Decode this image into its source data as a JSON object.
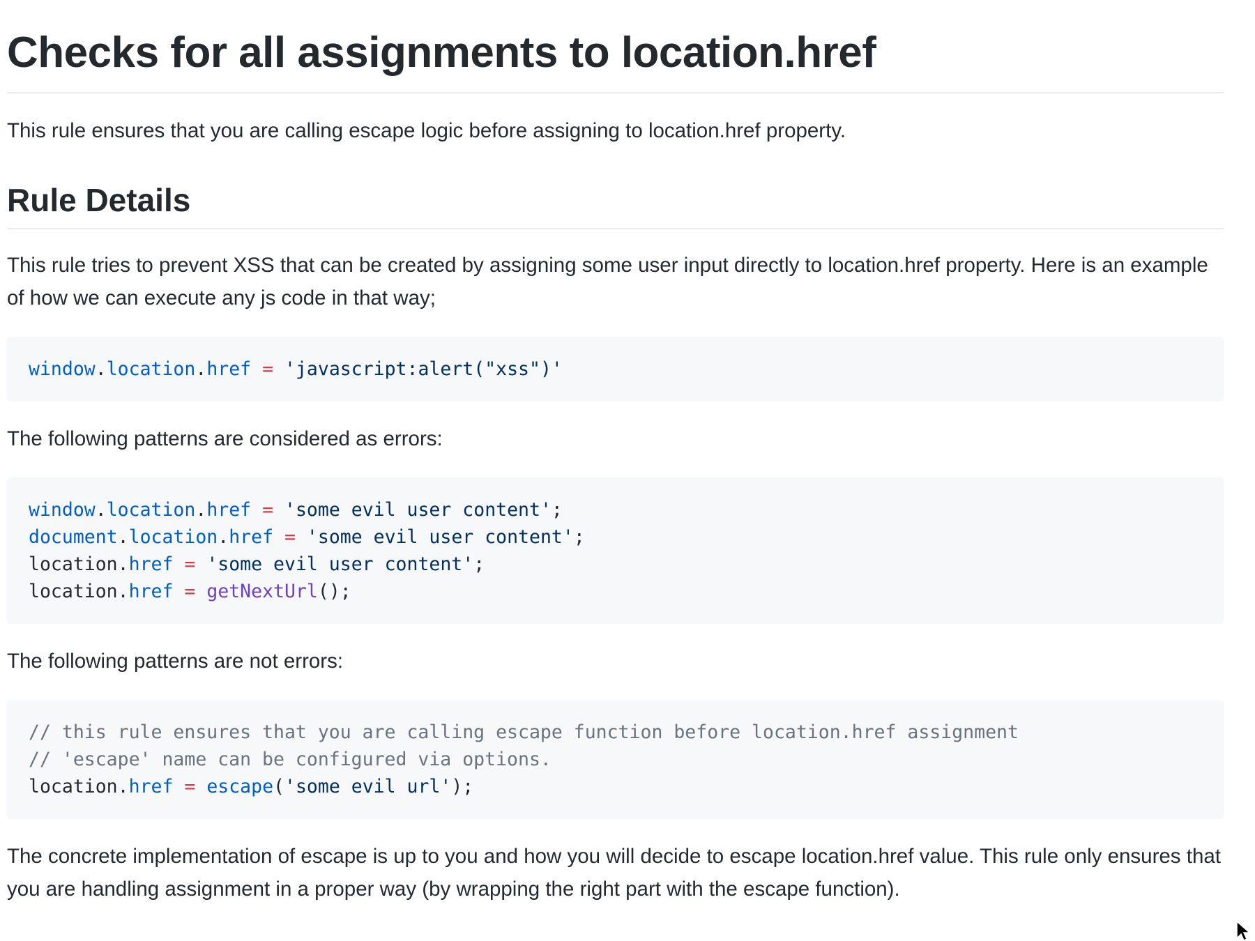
{
  "title": "Checks for all assignments to location.href",
  "intro": "This rule ensures that you are calling escape logic before assigning to location.href property.",
  "rule_details": {
    "heading": "Rule Details",
    "description": "This rule tries to prevent XSS that can be created by assigning some user input directly to location.href property. Here is an example of how we can execute any js code in that way;"
  },
  "example_code": {
    "lines": [
      [
        {
          "t": "window",
          "c": "kw"
        },
        {
          "t": ".",
          "c": "plain"
        },
        {
          "t": "location",
          "c": "kw"
        },
        {
          "t": ".",
          "c": "plain"
        },
        {
          "t": "href",
          "c": "kw"
        },
        {
          "t": " = ",
          "c": "op"
        },
        {
          "t": "'javascript:alert(\"xss\")'",
          "c": "str"
        }
      ]
    ]
  },
  "errors_intro": "The following patterns are considered as errors:",
  "errors_code": {
    "lines": [
      [
        {
          "t": "window",
          "c": "kw"
        },
        {
          "t": ".",
          "c": "plain"
        },
        {
          "t": "location",
          "c": "kw"
        },
        {
          "t": ".",
          "c": "plain"
        },
        {
          "t": "href",
          "c": "kw"
        },
        {
          "t": " = ",
          "c": "op"
        },
        {
          "t": "'some evil user content'",
          "c": "str"
        },
        {
          "t": ";",
          "c": "plain"
        }
      ],
      [
        {
          "t": "document",
          "c": "kw"
        },
        {
          "t": ".",
          "c": "plain"
        },
        {
          "t": "location",
          "c": "kw"
        },
        {
          "t": ".",
          "c": "plain"
        },
        {
          "t": "href",
          "c": "kw"
        },
        {
          "t": " = ",
          "c": "op"
        },
        {
          "t": "'some evil user content'",
          "c": "str"
        },
        {
          "t": ";",
          "c": "plain"
        }
      ],
      [
        {
          "t": "location",
          "c": "plain"
        },
        {
          "t": ".",
          "c": "plain"
        },
        {
          "t": "href",
          "c": "kw"
        },
        {
          "t": " = ",
          "c": "op"
        },
        {
          "t": "'some evil user content'",
          "c": "str"
        },
        {
          "t": ";",
          "c": "plain"
        }
      ],
      [
        {
          "t": "location",
          "c": "plain"
        },
        {
          "t": ".",
          "c": "plain"
        },
        {
          "t": "href",
          "c": "kw"
        },
        {
          "t": " = ",
          "c": "op"
        },
        {
          "t": "getNextUrl",
          "c": "fn"
        },
        {
          "t": "();",
          "c": "plain"
        }
      ]
    ]
  },
  "non_errors_intro": "The following patterns are not errors:",
  "non_errors_code": {
    "lines": [
      [
        {
          "t": "// this rule ensures that you are calling escape function before location.href assignment",
          "c": "cm"
        }
      ],
      [
        {
          "t": "// 'escape' name can be configured via options.",
          "c": "cm"
        }
      ],
      [
        {
          "t": "location",
          "c": "plain"
        },
        {
          "t": ".",
          "c": "plain"
        },
        {
          "t": "href",
          "c": "kw"
        },
        {
          "t": " = ",
          "c": "op"
        },
        {
          "t": "escape",
          "c": "kw"
        },
        {
          "t": "(",
          "c": "plain"
        },
        {
          "t": "'some evil url'",
          "c": "str"
        },
        {
          "t": ");",
          "c": "plain"
        }
      ]
    ]
  },
  "closing": "The concrete implementation of escape is up to you and how you will decide to escape location.href value. This rule only ensures that you are handling assignment in a proper way (by wrapping the right part with the escape function).",
  "cursor": {
    "icon": "mouse-pointer-icon"
  },
  "colors": {
    "text": "#24292e",
    "code_bg": "#f6f8fa",
    "keyword": "#005cc5",
    "operator": "#d73a49",
    "string": "#032f62",
    "function": "#6f42c1",
    "comment": "#6a737d",
    "divider": "#eaecef"
  }
}
